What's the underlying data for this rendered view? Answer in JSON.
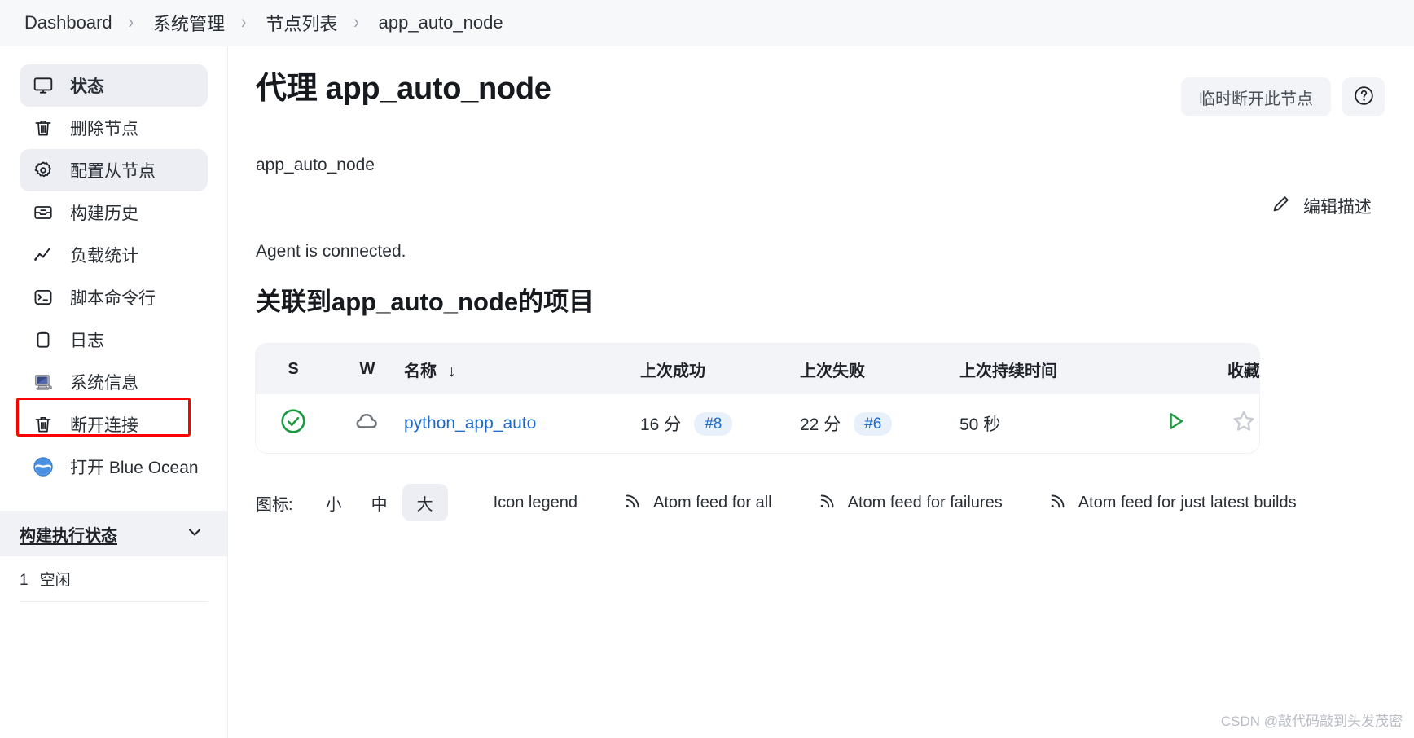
{
  "breadcrumb": {
    "items": [
      {
        "label": "Dashboard"
      },
      {
        "label": "系统管理"
      },
      {
        "label": "节点列表"
      },
      {
        "label": "app_auto_node"
      }
    ],
    "separator": "›"
  },
  "sidebar": {
    "items": [
      {
        "label": "状态",
        "icon": "monitor-icon",
        "state": "active"
      },
      {
        "label": "删除节点",
        "icon": "trash-icon",
        "state": "normal"
      },
      {
        "label": "配置从节点",
        "icon": "gear-icon",
        "state": "highlighted"
      },
      {
        "label": "构建历史",
        "icon": "inbox-icon",
        "state": "normal"
      },
      {
        "label": "负载统计",
        "icon": "trend-line-icon",
        "state": "normal"
      },
      {
        "label": "脚本命令行",
        "icon": "terminal-icon",
        "state": "normal"
      },
      {
        "label": "日志",
        "icon": "clipboard-icon",
        "state": "normal"
      },
      {
        "label": "系统信息",
        "icon": "computer-icon",
        "state": "normal"
      },
      {
        "label": "断开连接",
        "icon": "trash-icon",
        "state": "normal"
      },
      {
        "label": "打开 Blue Ocean",
        "icon": "blue-ocean-icon",
        "state": "normal"
      }
    ],
    "executors": {
      "title": "构建执行状态",
      "chevron": "chevron-down-icon",
      "rows": [
        {
          "number": "1",
          "status": "空闲"
        }
      ]
    }
  },
  "main": {
    "page_title": "代理 app_auto_node",
    "disconnect_button": "临时断开此节点",
    "help_button_icon": "help-circle-icon",
    "node_description": "app_auto_node",
    "edit_description_label": "编辑描述",
    "edit_description_icon": "pencil-icon",
    "agent_status": "Agent is connected.",
    "section_title": "关联到app_auto_node的项目"
  },
  "table": {
    "headers": {
      "s": "S",
      "w": "W",
      "name": "名称",
      "name_sort_arrow": "↓",
      "last_success": "上次成功",
      "last_failure": "上次失败",
      "last_duration": "上次持续时间",
      "favorite": "收藏"
    },
    "rows": [
      {
        "status_icon": "success-check-circle-icon",
        "weather_icon": "cloud-icon",
        "name": "python_app_auto",
        "last_success_time": "16 分",
        "last_success_build": "#8",
        "last_failure_time": "22 分",
        "last_failure_build": "#6",
        "last_duration": "50 秒",
        "run_icon": "play-triangle-icon",
        "favorite_icon": "star-outline-icon"
      }
    ]
  },
  "footer": {
    "icon_size_label": "图标:",
    "sizes": [
      {
        "label": "小",
        "selected": false
      },
      {
        "label": "中",
        "selected": false
      },
      {
        "label": "大",
        "selected": true
      }
    ],
    "links": [
      {
        "label": "Icon legend",
        "icon": "none"
      },
      {
        "label": "Atom feed for all",
        "icon": "rss-icon"
      },
      {
        "label": "Atom feed for failures",
        "icon": "rss-icon"
      },
      {
        "label": "Atom feed for just latest builds",
        "icon": "rss-icon"
      }
    ]
  },
  "watermark": "CSDN @敲代码敲到头发茂密",
  "colors": {
    "link": "#1b6ac9",
    "success": "#1a9b3f",
    "annotation": "#ff0000",
    "badge_bg": "#e8f1fb",
    "panel": "#f3f4f8"
  }
}
